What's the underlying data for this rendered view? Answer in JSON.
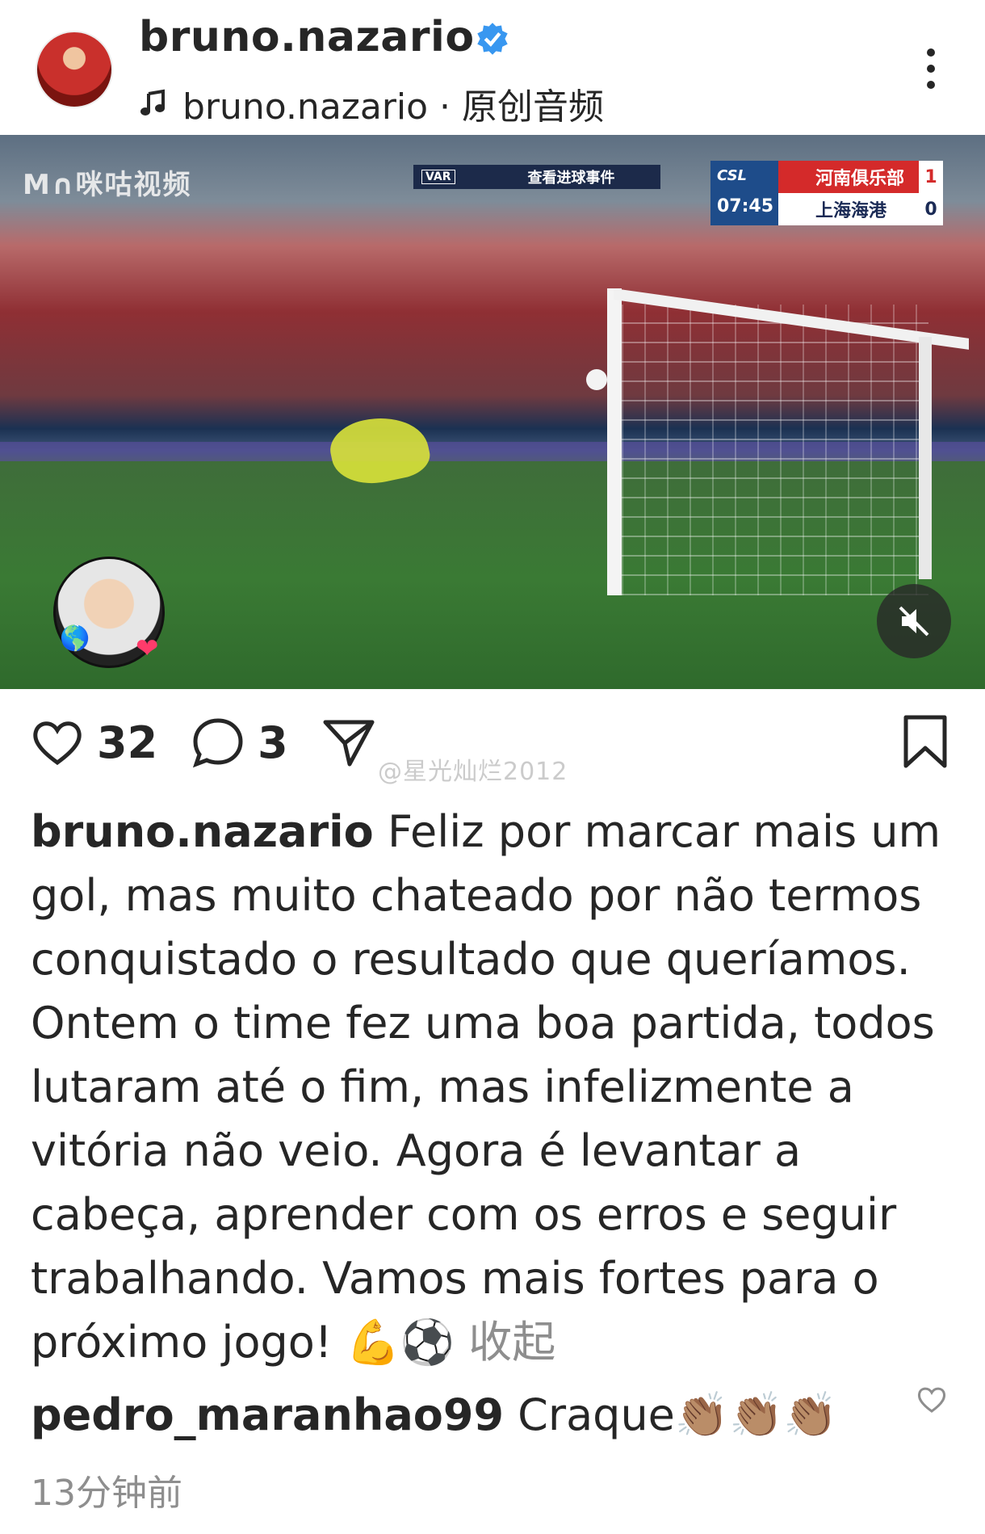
{
  "header": {
    "username": "bruno.nazario",
    "audio": "bruno.nazario · 原创音频"
  },
  "video": {
    "watermark": "M∩咪咕视频",
    "var_tag": "VAR",
    "var_title": "查看进球事件",
    "scoreboard": {
      "league": "CSL",
      "clock": "07:45",
      "team1": "河南俱乐部",
      "score1": "1",
      "team2": "上海海港",
      "score2": "0"
    }
  },
  "actions": {
    "likes": "32",
    "comments": "3"
  },
  "watermark_weibo": "@星光灿烂2012",
  "caption": {
    "author": "bruno.nazario",
    "text": " Feliz por marcar mais um gol, mas muito chateado por não termos conquistado o resultado que queríamos. Ontem o time fez uma boa partida, todos lutaram até o fim, mas infelizmente a vitória não veio. Agora é levantar a cabeça, aprender com os erros e seguir trabalhando. Vamos mais fortes para o próximo jogo! 💪⚽ ",
    "collapse": "收起"
  },
  "comment": {
    "author": "pedro_maranhao99",
    "text": " Craque👏🏽👏🏽👏🏽"
  },
  "timestamp": "13分钟前",
  "colors": {
    "text": "#262626",
    "secondary": "#8e8e8e",
    "verified": "#3897f0"
  }
}
